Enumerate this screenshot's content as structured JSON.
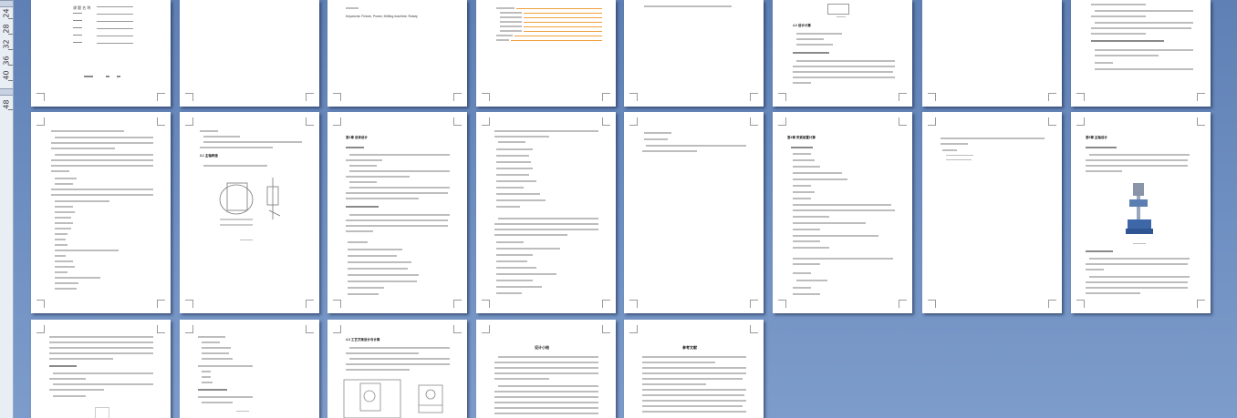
{
  "ruler": {
    "labels": [
      "24",
      "28",
      "32",
      "36",
      "40",
      "48"
    ]
  },
  "pages": [
    {
      "id": "p1"
    },
    {
      "id": "p2"
    },
    {
      "id": "p3"
    },
    {
      "id": "p4"
    },
    {
      "id": "p5"
    },
    {
      "id": "p6"
    },
    {
      "id": "p7"
    },
    {
      "id": "p8"
    },
    {
      "id": "p9"
    },
    {
      "id": "p10"
    },
    {
      "id": "p11"
    },
    {
      "id": "p12"
    },
    {
      "id": "p13"
    },
    {
      "id": "p14"
    },
    {
      "id": "p15"
    },
    {
      "id": "p16"
    },
    {
      "id": "p17"
    },
    {
      "id": "p18"
    },
    {
      "id": "p19"
    },
    {
      "id": "p20"
    },
    {
      "id": "p21"
    }
  ],
  "text": {
    "p3_keywords": "Keywords: Fixture, Power, Drilling machine, Rotary",
    "p19_heading": "设计小结",
    "p20_heading": "参考文献",
    "p17_heading": "4.1 工作台",
    "p18_heading": "4.2 设计计算",
    "p19_sub": "4.3 工艺方案设计与计算",
    "p16_heading": "第5章 主轴设计",
    "p9_heading": "第1章 总体设计",
    "p11_heading": "第2章 方案设计",
    "p14_heading": "第4章 夹紧装置计算",
    "p8_heading": "3.1 主轴转速"
  }
}
